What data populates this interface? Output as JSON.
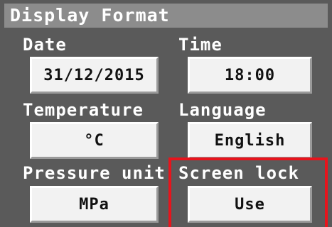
{
  "title": "Display Format",
  "settings": {
    "date": {
      "label": "Date",
      "value": "31/12/2015"
    },
    "time": {
      "label": "Time",
      "value": "18:00"
    },
    "temperature": {
      "label": "Temperature",
      "value": "°C"
    },
    "language": {
      "label": "Language",
      "value": "English"
    },
    "pressure_unit": {
      "label": "Pressure unit",
      "value": "MPa"
    },
    "screen_lock": {
      "label": "Screen lock",
      "value": "Use"
    }
  },
  "colors": {
    "background": "#5a5a5a",
    "title_bar": "#8c8c8c",
    "button": "#f2f2f2",
    "highlight": "#e8141c"
  }
}
